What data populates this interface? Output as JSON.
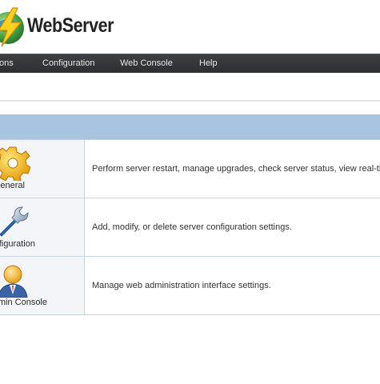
{
  "header": {
    "logo_text": "WebServer"
  },
  "nav": {
    "items": [
      {
        "label": "ons"
      },
      {
        "label": "Configuration"
      },
      {
        "label": "Web Console"
      },
      {
        "label": "Help"
      }
    ]
  },
  "table": {
    "rows": [
      {
        "label": "General",
        "description": "Perform server restart, manage upgrades, check server status, view real-time s",
        "icon": "gear-icon"
      },
      {
        "label": "onfiguration",
        "description": "Add, modify, or delete server configuration settings.",
        "icon": "wrench-icon"
      },
      {
        "label": "min Console",
        "description": "Manage web administration interface settings.",
        "icon": "admin-user-icon"
      }
    ]
  },
  "colors": {
    "nav_bg": "#2c2e31",
    "table_header": "#a9c4e0",
    "row_border": "#c6d6e6",
    "icon_cell_bg": "#f3f5f8"
  }
}
